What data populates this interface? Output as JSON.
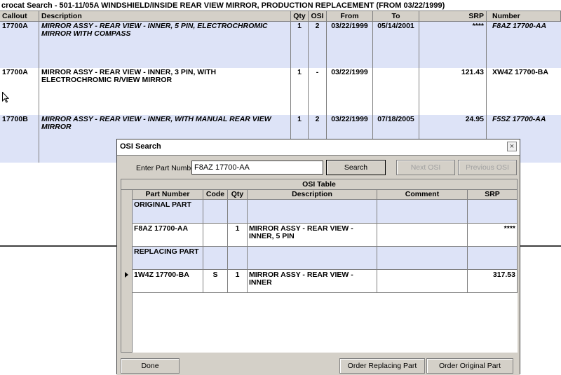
{
  "window": {
    "title": "crocat Search - 501-11/05A  WINDSHIELD/INSIDE REAR VIEW MIRROR, PRODUCTION REPLACEMENT (FROM 03/22/1999)"
  },
  "main_grid": {
    "headers": {
      "callout": "Callout",
      "description": "Description",
      "qty": "Qty",
      "osi": "OSI",
      "from": "From",
      "to": "To",
      "srp": "SRP",
      "number": "Number"
    },
    "rows": [
      {
        "callout": "17700A",
        "description": "MIRROR ASSY - REAR VIEW - INNER, 5 PIN, ELECTROCHROMIC MIRROR WITH COMPASS",
        "qty": "1",
        "osi": "2",
        "from": "03/22/1999",
        "to": "05/14/2001",
        "srp": "****",
        "number": "F8AZ 17700-AA"
      },
      {
        "callout": "17700A",
        "description": "MIRROR ASSY - REAR VIEW - INNER, 3 PIN, WITH ELECTROCHROMIC R/VIEW MIRROR",
        "qty": "1",
        "osi": "-",
        "from": "03/22/1999",
        "to": "",
        "srp": "121.43",
        "number": "XW4Z 17700-BA"
      },
      {
        "callout": "17700B",
        "description": "MIRROR ASSY - REAR VIEW - INNER, WITH MANUAL REAR VIEW MIRROR",
        "qty": "1",
        "osi": "2",
        "from": "03/22/1999",
        "to": "07/18/2005",
        "srp": "24.95",
        "number": "F5SZ 17700-AA"
      }
    ]
  },
  "dialog": {
    "title": "OSI Search",
    "close_glyph": "×",
    "part_label": "Enter Part Number:",
    "part_value": "F8AZ 17700-AA",
    "search_label": "Search",
    "next_label": "Next OSI",
    "prev_label": "Previous OSI",
    "table_caption": "OSI Table",
    "headers": {
      "part": "Part Number",
      "code": "Code",
      "qty": "Qty",
      "description": "Description",
      "comment": "Comment",
      "srp": "SRP"
    },
    "rows": [
      {
        "part": "ORIGINAL PART",
        "code": "",
        "qty": "",
        "description": "",
        "comment": "",
        "srp": ""
      },
      {
        "part": "F8AZ 17700-AA",
        "code": "",
        "qty": "1",
        "description": "MIRROR ASSY - REAR VIEW - INNER, 5 PIN",
        "comment": "",
        "srp": "****"
      },
      {
        "part": "REPLACING PART",
        "code": "",
        "qty": "",
        "description": "",
        "comment": "",
        "srp": ""
      },
      {
        "part": "1W4Z 17700-BA",
        "code": "S",
        "qty": "1",
        "description": "MIRROR ASSY - REAR VIEW - INNER",
        "comment": "",
        "srp": "317.53"
      }
    ],
    "done_label": "Done",
    "order_replacing_label": "Order Replacing Part",
    "order_original_label": "Order Original Part"
  },
  "colors": {
    "row_shade": "#dde3f7",
    "chrome": "#d4d0c8"
  }
}
